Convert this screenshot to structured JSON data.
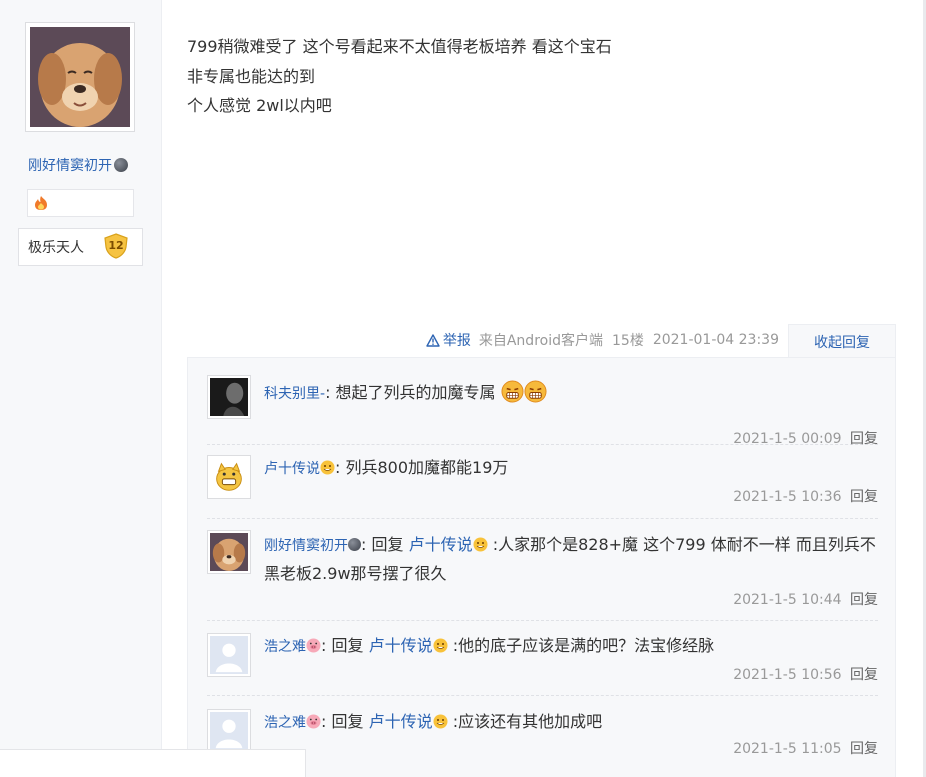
{
  "author": {
    "username": "刚好情窦初开",
    "level_title": "极乐天人",
    "level_number": "12"
  },
  "post": {
    "lines": [
      "799稍微难受了 这个号看起来不太值得老板培养 看这个宝石",
      "非专属也能达的到",
      "个人感觉 2wl以内吧"
    ],
    "report_label": "举报",
    "source": "来自Android客户端",
    "floor": "15楼",
    "time": "2021-01-04 23:39",
    "fold_label": "收起回复"
  },
  "reply_label": "回复",
  "replies": [
    {
      "user": "科夫别里-",
      "sep": ":",
      "text": "想起了列兵的加魔专属",
      "time": "2021-1-5 00:09",
      "reply": "回复"
    },
    {
      "user": "卢十传说",
      "sep": ":",
      "text": "列兵800加魔都能19万",
      "time": "2021-1-5 10:36",
      "reply": "回复"
    },
    {
      "user": "刚好情窦初开",
      "sep": ":",
      "prefix": "回复",
      "target": "卢十传说",
      "text": ":人家那个是828+魔 这个799 体耐不一样 而且列兵不黑老板2.9w那号摆了很久",
      "time": "2021-1-5 10:44",
      "reply": "回复"
    },
    {
      "user": "浩之难",
      "sep": ":",
      "prefix": "回复",
      "target": "卢十传说",
      "text": ":他的底子应该是满的吧？法宝修经脉",
      "time": "2021-1-5 10:56",
      "reply": "回复"
    },
    {
      "user": "浩之难",
      "sep": ":",
      "prefix": "回复",
      "target": "卢十传说",
      "text": ":应该还有其他加成吧",
      "time": "2021-1-5 11:05",
      "reply": "回复"
    }
  ],
  "colors": {
    "link": "#2d64b3",
    "meta": "#999999",
    "panel": "#f7f8fa"
  }
}
